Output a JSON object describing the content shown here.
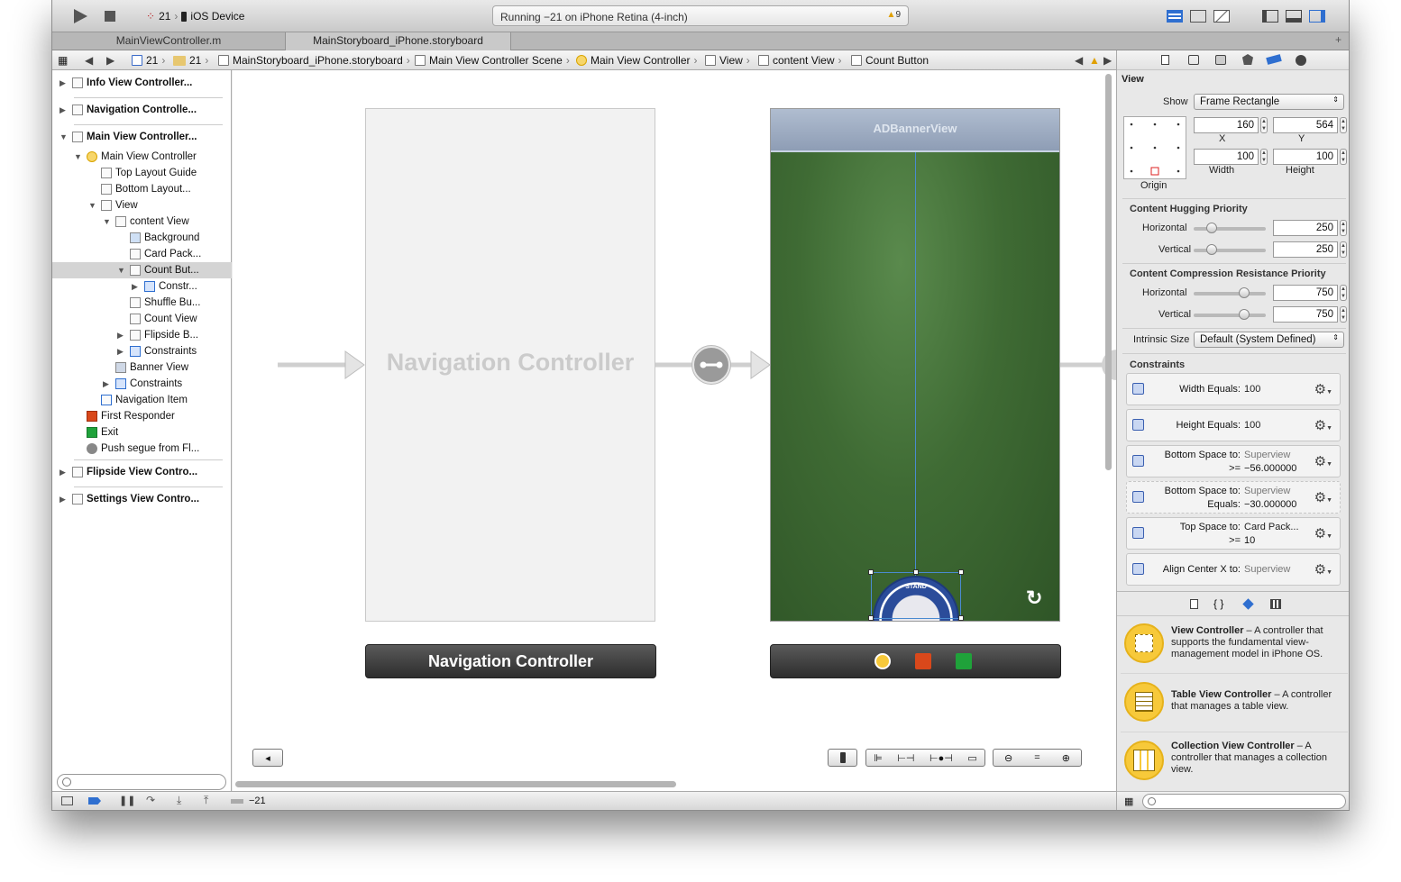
{
  "toolbar": {
    "scheme_count": "21",
    "scheme_device": "iOS Device",
    "activity": "Running −21 on iPhone Retina (4-inch)",
    "warnings": "9"
  },
  "tabs": [
    "MainViewController.m",
    "MainStoryboard_iPhone.storyboard"
  ],
  "jumpbar": {
    "items": [
      "21",
      "21",
      "MainStoryboard_iPhone.storyboard",
      "Main View Controller Scene",
      "Main View Controller",
      "View",
      "content View",
      "Count Button"
    ]
  },
  "navigator": {
    "scenes": [
      "Info View Controller...",
      "Navigation Controlle...",
      "Main View Controller...",
      "Flipside View Contro...",
      "Settings View Contro..."
    ],
    "tree": [
      "Main View Controller",
      "Top Layout Guide",
      "Bottom Layout...",
      "View",
      "content View",
      "Background",
      "Card Pack...",
      "Count But...",
      "Constr...",
      "Shuffle Bu...",
      "Count View",
      "Flipside B...",
      "Constraints",
      "Banner View",
      "Constraints",
      "Navigation Item",
      "First Responder",
      "Exit",
      "Push segue from Fl..."
    ]
  },
  "canvas": {
    "nav_controller_placeholder": "Navigation Controller",
    "nav_controller_dock": "Navigation Controller",
    "banner": "ADBannerView",
    "chip_text": "STAND"
  },
  "inspector": {
    "section_title": "View",
    "show_label": "Show",
    "show_value": "Frame Rectangle",
    "x": "160",
    "y": "564",
    "width": "100",
    "height": "100",
    "x_label": "X",
    "y_label": "Y",
    "width_label": "Width",
    "height_label": "Height",
    "origin_label": "Origin",
    "hugging_title": "Content Hugging Priority",
    "horizontal_label": "Horizontal",
    "vertical_label": "Vertical",
    "hug_h": "250",
    "hug_v": "250",
    "compression_title": "Content Compression Resistance Priority",
    "comp_h": "750",
    "comp_v": "750",
    "intrinsic_label": "Intrinsic Size",
    "intrinsic_value": "Default (System Defined)",
    "constraints_title": "Constraints",
    "constraints": [
      {
        "l1": "Width Equals:",
        "v1": "100",
        "l2": "",
        "v2": ""
      },
      {
        "l1": "Height Equals:",
        "v1": "100",
        "l2": "",
        "v2": ""
      },
      {
        "l1": "Bottom Space to:",
        "v1": "Superview",
        "l2": ">=",
        "v2": "−56.000000"
      },
      {
        "l1": "Bottom Space to:",
        "v1": "Superview",
        "l2": "Equals:",
        "v2": "−30.000000"
      },
      {
        "l1": "Top Space to:",
        "v1": "Card Pack...",
        "l2": ">=",
        "v2": "10"
      },
      {
        "l1": "Align Center X to:",
        "v1": "Superview",
        "l2": "",
        "v2": ""
      }
    ]
  },
  "library": [
    {
      "title": "View Controller",
      "desc": "– A controller that supports the fundamental view-management model in iPhone OS."
    },
    {
      "title": "Table View Controller",
      "desc": "– A controller that manages a table view."
    },
    {
      "title": "Collection View Controller",
      "desc": "– A controller that manages a collection view."
    }
  ],
  "debug": {
    "label": "−21"
  },
  "colors": {
    "felt": "#3f6b34",
    "banner": "#9aa9bf",
    "accent": "#2f6fd0"
  }
}
